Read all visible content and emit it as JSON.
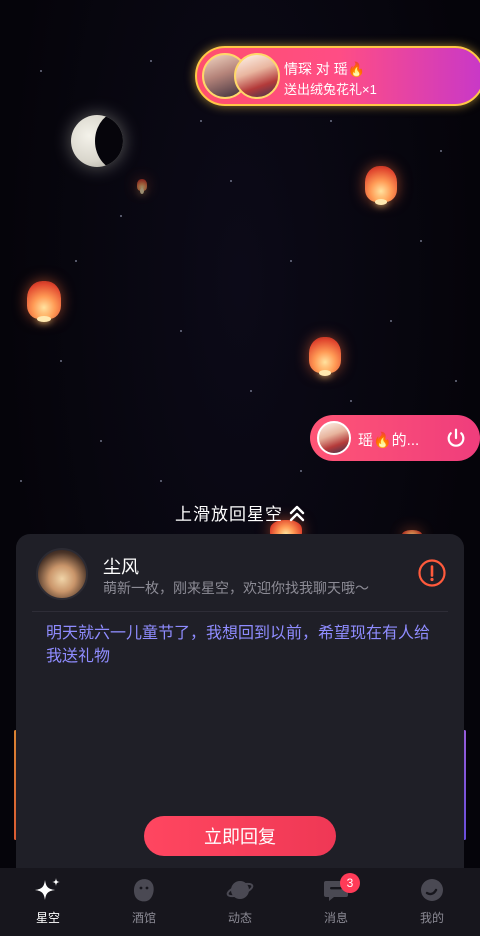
{
  "gift_banner": {
    "line1": "情琛 对 瑶🔥",
    "line2": "送出绒兔花礼×1"
  },
  "user_pill": {
    "label": "瑶🔥的..."
  },
  "swipe_hint": "上滑放回星空",
  "card": {
    "name": "尘风",
    "bio": "萌新一枚，刚来星空，欢迎你找我聊天哦～",
    "message": "明天就六一儿童节了，我想回到以前，希望现在有人给我送礼物",
    "reply_button": "立即回复"
  },
  "tabbar": {
    "tabs": [
      {
        "label": "星空",
        "icon": "sparkle-icon",
        "active": true
      },
      {
        "label": "酒馆",
        "icon": "tavern-icon",
        "active": false
      },
      {
        "label": "动态",
        "icon": "planet-icon",
        "active": false
      },
      {
        "label": "消息",
        "icon": "chat-bubble-icon",
        "active": false
      },
      {
        "label": "我的",
        "icon": "profile-icon",
        "active": false
      }
    ],
    "messages_badge": "3"
  },
  "colors": {
    "accent": "#ff4660",
    "message_text": "#8f8cff",
    "card_bg": "#1f1f27",
    "gift_border": "#ffc846"
  }
}
